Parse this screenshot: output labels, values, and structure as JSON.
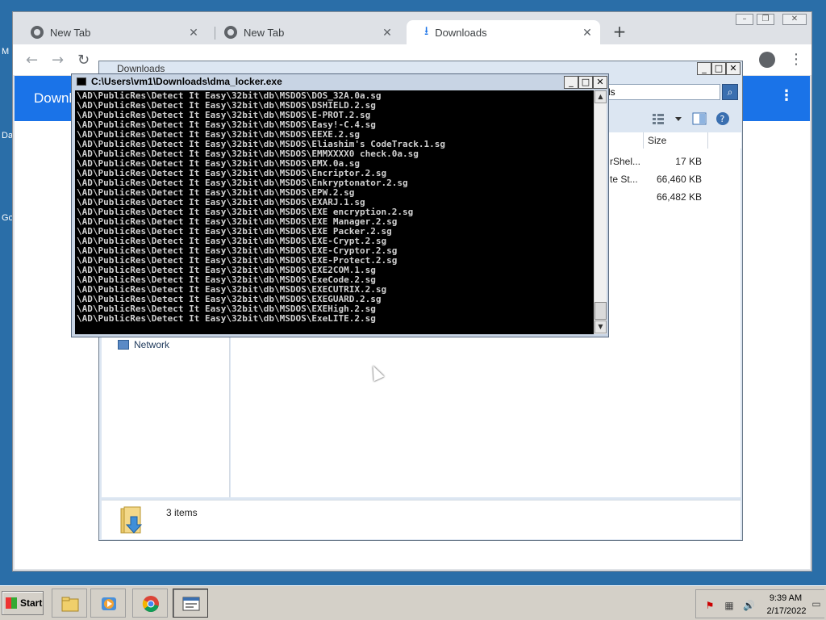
{
  "desktop": {
    "labels": [
      "M",
      "Da",
      "Go"
    ]
  },
  "chrome": {
    "tabs": [
      {
        "label": "New Tab",
        "active": false
      },
      {
        "label": "New Tab",
        "active": false
      },
      {
        "label": "Downloads",
        "active": true
      }
    ],
    "new_tab_glyph": "+",
    "downloads_page": {
      "title": "Downloads"
    }
  },
  "explorer": {
    "title": "Downloads",
    "search_text": "ds",
    "column_size": "Size",
    "files": [
      {
        "name": "rShel...",
        "size": "17 KB"
      },
      {
        "name": "te St...",
        "size": "66,460 KB"
      },
      {
        "name": "",
        "size": "66,482 KB"
      }
    ],
    "nav_network": "Network",
    "status_items": "3 items"
  },
  "console": {
    "title": "C:\\Users\\vm1\\Downloads\\dma_locker.exe",
    "lines": [
      "\\AD\\PublicRes\\Detect It Easy\\32bit\\db\\MSDOS\\DOS_32A.0a.sg",
      "\\AD\\PublicRes\\Detect It Easy\\32bit\\db\\MSDOS\\DSHIELD.2.sg",
      "\\AD\\PublicRes\\Detect It Easy\\32bit\\db\\MSDOS\\E-PROT.2.sg",
      "\\AD\\PublicRes\\Detect It Easy\\32bit\\db\\MSDOS\\Easy!-C.4.sg",
      "\\AD\\PublicRes\\Detect It Easy\\32bit\\db\\MSDOS\\EEXE.2.sg",
      "\\AD\\PublicRes\\Detect It Easy\\32bit\\db\\MSDOS\\Eliashim's CodeTrack.1.sg",
      "\\AD\\PublicRes\\Detect It Easy\\32bit\\db\\MSDOS\\EMMXXXX0 check.0a.sg",
      "\\AD\\PublicRes\\Detect It Easy\\32bit\\db\\MSDOS\\EMX.0a.sg",
      "\\AD\\PublicRes\\Detect It Easy\\32bit\\db\\MSDOS\\Encriptor.2.sg",
      "\\AD\\PublicRes\\Detect It Easy\\32bit\\db\\MSDOS\\Enkryptonator.2.sg",
      "\\AD\\PublicRes\\Detect It Easy\\32bit\\db\\MSDOS\\EPW.2.sg",
      "\\AD\\PublicRes\\Detect It Easy\\32bit\\db\\MSDOS\\EXARJ.1.sg",
      "\\AD\\PublicRes\\Detect It Easy\\32bit\\db\\MSDOS\\EXE encryption.2.sg",
      "\\AD\\PublicRes\\Detect It Easy\\32bit\\db\\MSDOS\\EXE Manager.2.sg",
      "\\AD\\PublicRes\\Detect It Easy\\32bit\\db\\MSDOS\\EXE Packer.2.sg",
      "\\AD\\PublicRes\\Detect It Easy\\32bit\\db\\MSDOS\\EXE-Crypt.2.sg",
      "\\AD\\PublicRes\\Detect It Easy\\32bit\\db\\MSDOS\\EXE-Cryptor.2.sg",
      "\\AD\\PublicRes\\Detect It Easy\\32bit\\db\\MSDOS\\EXE-Protect.2.sg",
      "\\AD\\PublicRes\\Detect It Easy\\32bit\\db\\MSDOS\\EXE2COM.1.sg",
      "\\AD\\PublicRes\\Detect It Easy\\32bit\\db\\MSDOS\\ExeCode.2.sg",
      "\\AD\\PublicRes\\Detect It Easy\\32bit\\db\\MSDOS\\EXECUTRIX.2.sg",
      "\\AD\\PublicRes\\Detect It Easy\\32bit\\db\\MSDOS\\EXEGUARD.2.sg",
      "\\AD\\PublicRes\\Detect It Easy\\32bit\\db\\MSDOS\\EXEHigh.2.sg",
      "\\AD\\PublicRes\\Detect It Easy\\32bit\\db\\MSDOS\\ExeLITE.2.sg"
    ]
  },
  "taskbar": {
    "start_label": "Start",
    "apps": [
      {
        "icon": "file-explorer-icon"
      },
      {
        "icon": "media-player-icon"
      },
      {
        "icon": "chrome-icon"
      },
      {
        "icon": "console-window-icon"
      }
    ],
    "clock_time": "9:39 AM",
    "clock_date": "2/17/2022"
  },
  "colors": {
    "chrome_accent": "#1a73e8",
    "console_bg": "#000000",
    "console_fg": "#d0d0d0",
    "desktop_bg": "#2a6ea8"
  }
}
